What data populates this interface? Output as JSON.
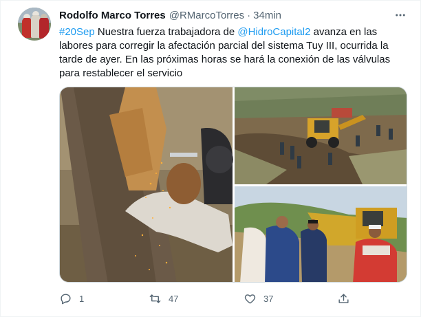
{
  "tweet": {
    "author_name": "Rodolfo Marco Torres",
    "author_handle": "@RMarcoTorres",
    "separator": "·",
    "time": "34min",
    "text": {
      "hashtag": "#20Sep",
      "part1": " Nuestra fuerza trabajadora de ",
      "mention": "@HidroCapital2",
      "part2": " avanza en las labores para corregir la afectación parcial del sistema Tuy III, ocurrida la tarde de ayer. En las próximas horas se hará la conexión de las válvulas para restablecer el servicio"
    },
    "media": {
      "photos": [
        {
          "subject": "welder cutting pipe"
        },
        {
          "subject": "backhoe excavation site with workers"
        },
        {
          "subject": "officials near backhoe"
        }
      ]
    },
    "actions": {
      "reply_count": "1",
      "retweet_count": "47",
      "like_count": "37",
      "share_count": ""
    }
  },
  "colors": {
    "link": "#1d9bf0",
    "secondary_text": "#536471",
    "primary_text": "#0f1419"
  },
  "icons": {
    "more": "more-horizontal-icon",
    "reply": "reply-icon",
    "retweet": "retweet-icon",
    "like": "like-icon",
    "share": "share-icon"
  }
}
